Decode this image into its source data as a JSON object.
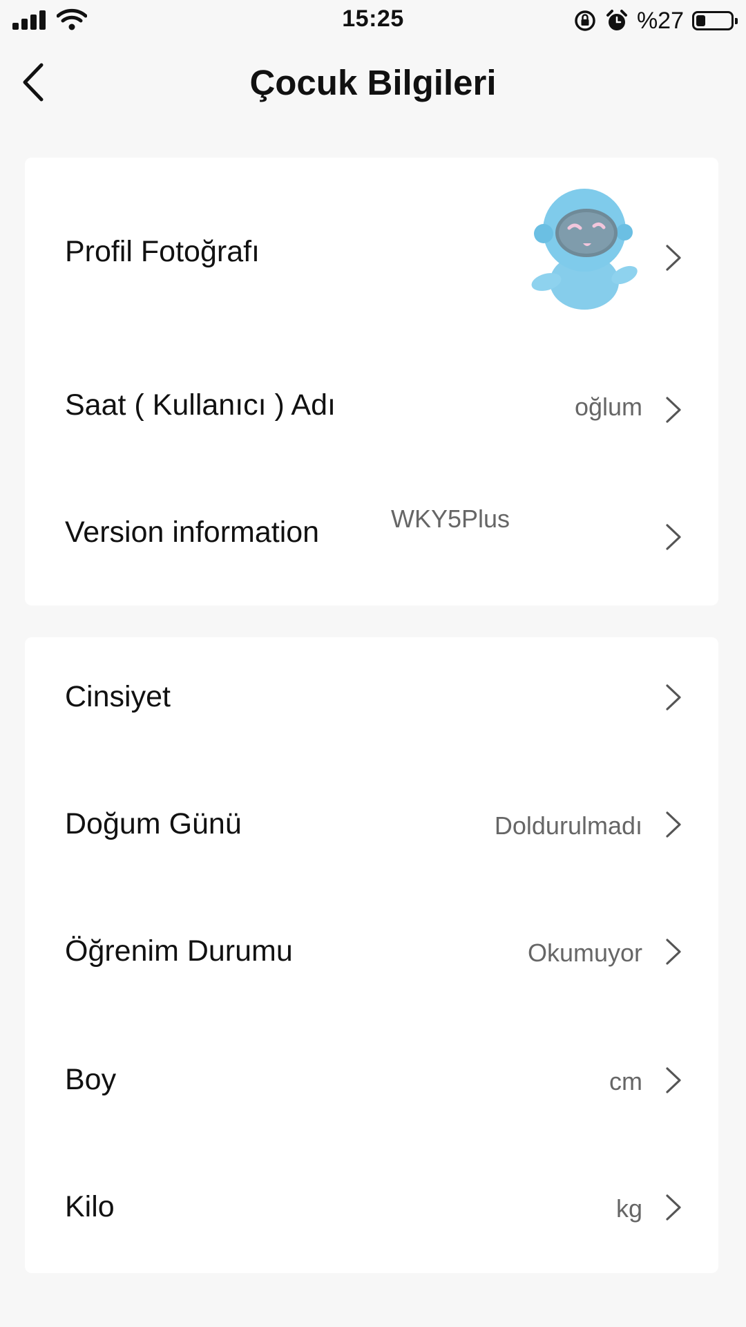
{
  "status_bar": {
    "time": "15:25",
    "battery_text": "%27",
    "battery_level": 0.27,
    "icons": [
      "signal-icon",
      "wifi-icon",
      "rotation-lock-icon",
      "alarm-icon",
      "battery-icon"
    ]
  },
  "header": {
    "title": "Çocuk Bilgileri",
    "back_icon": "chevron-left-icon"
  },
  "section_1": {
    "rows": [
      {
        "label": "Profil Fotoğrafı",
        "value": "",
        "avatar": "robot-avatar"
      },
      {
        "label": "Saat ( Kullanıcı ) Adı",
        "value": "oğlum"
      },
      {
        "label": "Version information",
        "value": "WKY5Plus"
      }
    ]
  },
  "section_2": {
    "rows": [
      {
        "label": "Cinsiyet",
        "value": ""
      },
      {
        "label": "Doğum Günü",
        "value": "Doldurulmadı"
      },
      {
        "label": "Öğrenim Durumu",
        "value": "Okumuyor"
      },
      {
        "label": "Boy",
        "value": "cm"
      },
      {
        "label": "Kilo",
        "value": "kg"
      }
    ]
  },
  "colors": {
    "background": "#f7f7f7",
    "card": "#ffffff",
    "text_primary": "#111111",
    "text_secondary": "#666666",
    "chevron": "#555555",
    "avatar_blue": "#7fcbeb"
  }
}
